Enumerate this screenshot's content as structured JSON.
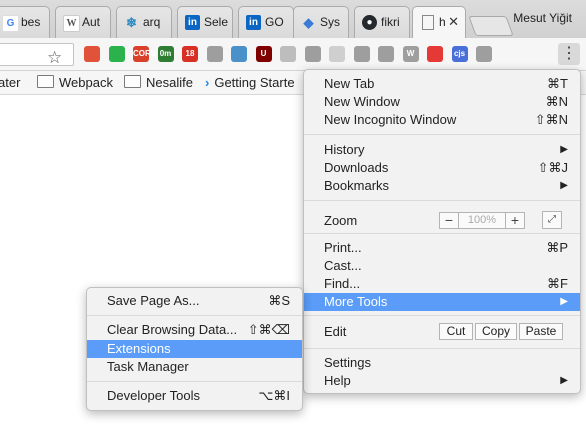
{
  "tabs": [
    {
      "label": "bes",
      "icon": "google-icon",
      "color": "#4285f4"
    },
    {
      "label": "Aut",
      "icon": "wikipedia-icon",
      "color": "#777777"
    },
    {
      "label": "arq",
      "icon": "snowflake-icon",
      "color": "#2b8bc4"
    },
    {
      "label": "Sele",
      "icon": "linkedin-icon",
      "color": "#0a66c2"
    },
    {
      "label": "GO",
      "icon": "linkedin-icon",
      "color": "#0a66c2"
    },
    {
      "label": "Sys",
      "icon": "diamond-icon",
      "color": "#3a7bd5"
    },
    {
      "label": "fikri",
      "icon": "github-icon",
      "color": "#24292e"
    },
    {
      "label": "h",
      "icon": "page-icon",
      "color": "#888888"
    }
  ],
  "profile_name": "Mesut Yiğit",
  "bookmarks": [
    {
      "label": "ater"
    },
    {
      "label": "Webpack"
    },
    {
      "label": "Nesalife"
    },
    {
      "label": "Getting Starte"
    }
  ],
  "main_menu": {
    "new_tab": "New Tab",
    "new_tab_sc": "⌘T",
    "new_window": "New Window",
    "new_window_sc": "⌘N",
    "new_incognito": "New Incognito Window",
    "new_incognito_sc": "⇧⌘N",
    "history": "History",
    "downloads": "Downloads",
    "downloads_sc": "⇧⌘J",
    "bookmarks": "Bookmarks",
    "zoom": "Zoom",
    "zoom_minus": "−",
    "zoom_value": "100%",
    "zoom_plus": "+",
    "print": "Print...",
    "print_sc": "⌘P",
    "cast": "Cast...",
    "find": "Find...",
    "find_sc": "⌘F",
    "more_tools": "More Tools",
    "edit": "Edit",
    "cut": "Cut",
    "copy": "Copy",
    "paste": "Paste",
    "settings": "Settings",
    "help": "Help"
  },
  "sub_menu": {
    "save_page": "Save Page As...",
    "save_page_sc": "⌘S",
    "clear_data": "Clear Browsing Data...",
    "clear_data_sc": "⇧⌘⌫",
    "extensions": "Extensions",
    "task_manager": "Task Manager",
    "dev_tools": "Developer Tools",
    "dev_tools_sc": "⌥⌘I"
  },
  "extensions": [
    {
      "icon": "cookie-icon",
      "color": "#e0523a",
      "text": ""
    },
    {
      "icon": "green-d-icon",
      "color": "#2bb24c",
      "text": ""
    },
    {
      "icon": "cors-icon",
      "color": "#d9412b",
      "text": "CORS"
    },
    {
      "icon": "timer-icon",
      "color": "#2e7d32",
      "text": "0m"
    },
    {
      "icon": "gmail-icon",
      "color": "#d93025",
      "text": "18"
    },
    {
      "icon": "camera-icon",
      "color": "#9e9e9e",
      "text": ""
    },
    {
      "icon": "note-icon",
      "color": "#4a90c9",
      "text": ""
    },
    {
      "icon": "ublock-icon",
      "color": "#800000",
      "text": "U"
    },
    {
      "icon": "grid-icon",
      "color": "#bdbdbd",
      "text": ""
    },
    {
      "icon": "screen-icon",
      "color": "#9e9e9e",
      "text": ""
    },
    {
      "icon": "drop-icon",
      "color": "#cfcfcf",
      "text": ""
    },
    {
      "icon": "checklist-icon",
      "color": "#9e9e9e",
      "text": ""
    },
    {
      "icon": "cube-icon",
      "color": "#9e9e9e",
      "text": ""
    },
    {
      "icon": "wiki-w-icon",
      "color": "#9e9e9e",
      "text": "W"
    },
    {
      "icon": "red-circle-icon",
      "color": "#e53935",
      "text": ""
    },
    {
      "icon": "cjs-icon",
      "color": "#4a6fd8",
      "text": "cjs"
    },
    {
      "icon": "puzzle-icon",
      "color": "#9e9e9e",
      "text": ""
    }
  ]
}
